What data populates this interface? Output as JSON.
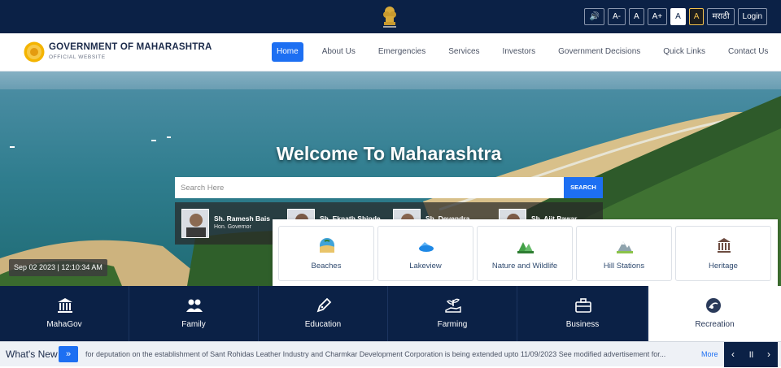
{
  "topbar": {
    "tools": [
      {
        "id": "speaker",
        "label": "🔊"
      },
      {
        "id": "font-decrease",
        "label": "A-"
      },
      {
        "id": "font-normal",
        "label": "A"
      },
      {
        "id": "font-increase",
        "label": "A+"
      },
      {
        "id": "theme-light",
        "label": "A"
      },
      {
        "id": "theme-dark",
        "label": "A"
      },
      {
        "id": "language",
        "label": "मराठी"
      },
      {
        "id": "login",
        "label": "Login"
      }
    ]
  },
  "header": {
    "title": "GOVERNMENT OF MAHARASHTRA",
    "subtitle": "OFFICIAL WEBSITE",
    "nav": [
      "Home",
      "About Us",
      "Emergencies",
      "Services",
      "Investors",
      "Government Decisions",
      "Quick Links",
      "Contact Us"
    ],
    "active_nav": "Home"
  },
  "hero": {
    "title": "Welcome To Maharashtra",
    "search_placeholder": "Search Here",
    "search_button": "SEARCH",
    "datetime": "Sep 02 2023 | 12:10:34 AM",
    "leaders": [
      {
        "name": "Sh. Ramesh Bais",
        "role": "Hon. Governor"
      },
      {
        "name": "Sh. Eknath Shinde",
        "role": ""
      },
      {
        "name": "Sh. Devendra",
        "role": ""
      },
      {
        "name": "Sh. Ajit Pawar",
        "role": ""
      }
    ]
  },
  "recreation": {
    "items": [
      {
        "label": "Beaches",
        "icon": "beach-icon"
      },
      {
        "label": "Lakeview",
        "icon": "lake-icon"
      },
      {
        "label": "Nature and Wildlife",
        "icon": "nature-icon"
      },
      {
        "label": "Hill Stations",
        "icon": "mountain-icon"
      },
      {
        "label": "Heritage",
        "icon": "monument-icon"
      }
    ]
  },
  "categories": {
    "items": [
      {
        "label": "MahaGov",
        "icon": "government-building-icon"
      },
      {
        "label": "Family",
        "icon": "family-icon"
      },
      {
        "label": "Education",
        "icon": "pen-icon"
      },
      {
        "label": "Farming",
        "icon": "plant-hand-icon"
      },
      {
        "label": "Business",
        "icon": "briefcase-icon"
      },
      {
        "label": "Recreation",
        "icon": "recreation-icon"
      }
    ],
    "active": "Recreation"
  },
  "whats_new": {
    "label": "What's New",
    "text": "for deputation on the establishment of Sant Rohidas Leather Industry and Charmkar Development Corporation is being extended upto 11/09/2023 See modified advertisement for...",
    "more": "More"
  },
  "colors": {
    "navy": "#0b2146",
    "accent": "#1d6ff2"
  }
}
